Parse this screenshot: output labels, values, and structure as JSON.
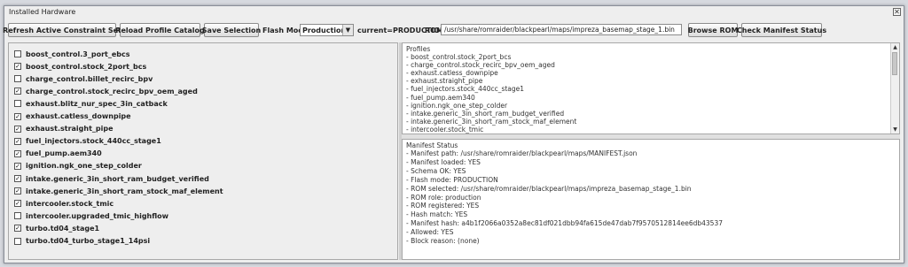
{
  "window": {
    "title": "Installed Hardware"
  },
  "toolbar": {
    "refresh_label": "Refresh Active Constraint Set",
    "reload_label": "Reload Profile Catalog",
    "save_label": "Save Selection",
    "flash_mode_label": "Flash Mode:",
    "flash_mode_value": "Production",
    "current_label": "current=PRODUCTION",
    "rom_label": "ROM:",
    "rom_path": "/usr/share/romraider/blackpearl/maps/impreza_basemap_stage_1.bin",
    "browse_label": "Browse ROM",
    "check_label": "Check Manifest Status"
  },
  "hardware": [
    {
      "label": "boost_control.3_port_ebcs",
      "checked": false
    },
    {
      "label": "boost_control.stock_2port_bcs",
      "checked": true
    },
    {
      "label": "charge_control.billet_recirc_bpv",
      "checked": false
    },
    {
      "label": "charge_control.stock_recirc_bpv_oem_aged",
      "checked": true
    },
    {
      "label": "exhaust.blitz_nur_spec_3in_catback",
      "checked": false
    },
    {
      "label": "exhaust.catless_downpipe",
      "checked": true
    },
    {
      "label": "exhaust.straight_pipe",
      "checked": true
    },
    {
      "label": "fuel_injectors.stock_440cc_stage1",
      "checked": true
    },
    {
      "label": "fuel_pump.aem340",
      "checked": true
    },
    {
      "label": "ignition.ngk_one_step_colder",
      "checked": true
    },
    {
      "label": "intake.generic_3in_short_ram_budget_verified",
      "checked": true
    },
    {
      "label": "intake.generic_3in_short_ram_stock_maf_element",
      "checked": true
    },
    {
      "label": "intercooler.stock_tmic",
      "checked": true
    },
    {
      "label": "intercooler.upgraded_tmic_highflow",
      "checked": false
    },
    {
      "label": "turbo.td04_stage1",
      "checked": true
    },
    {
      "label": "turbo.td04_turbo_stage1_14psi",
      "checked": false
    }
  ],
  "profiles": {
    "header": "Profiles",
    "lines": [
      "- boost_control.stock_2port_bcs",
      "- charge_control.stock_recirc_bpv_oem_aged",
      "- exhaust.catless_downpipe",
      "- exhaust.straight_pipe",
      "- fuel_injectors.stock_440cc_stage1",
      "- fuel_pump.aem340",
      "- ignition.ngk_one_step_colder",
      "- intake.generic_3in_short_ram_budget_verified",
      "- intake.generic_3in_short_ram_stock_maf_element",
      "- intercooler.stock_tmic"
    ]
  },
  "manifest": {
    "header": "Manifest Status",
    "lines": [
      "- Manifest path: /usr/share/romraider/blackpearl/maps/MANIFEST.json",
      "- Manifest loaded: YES",
      "- Schema OK: YES",
      "- Flash mode: PRODUCTION",
      "- ROM selected: /usr/share/romraider/blackpearl/maps/impreza_basemap_stage_1.bin",
      "- ROM role: production",
      "- ROM registered: YES",
      "- Hash match: YES",
      "- Manifest hash: a4b1f2066a0352a8ec81df021dbb94fa615de47dab7f9570512814ee6db43537",
      "- Allowed: YES",
      "- Block reason: (none)"
    ]
  },
  "icons": {
    "close": "close-icon",
    "dropdown": "chevron-down-icon",
    "check": "checkmark-icon"
  }
}
